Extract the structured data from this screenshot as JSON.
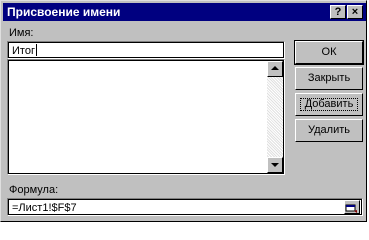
{
  "window": {
    "title": "Присвоение имени",
    "help_label": "?",
    "close_label": "×"
  },
  "name_section": {
    "label": "Имя:",
    "value": "Итог"
  },
  "names_list": {
    "items": []
  },
  "formula_section": {
    "label": "Формула:",
    "value": "=Лист1!$F$7"
  },
  "buttons": {
    "ok": "ОК",
    "close": "Закрыть",
    "add": "Добавить",
    "delete": "Удалить"
  },
  "colors": {
    "titlebar": "#000080",
    "face": "#c0c0c0"
  }
}
